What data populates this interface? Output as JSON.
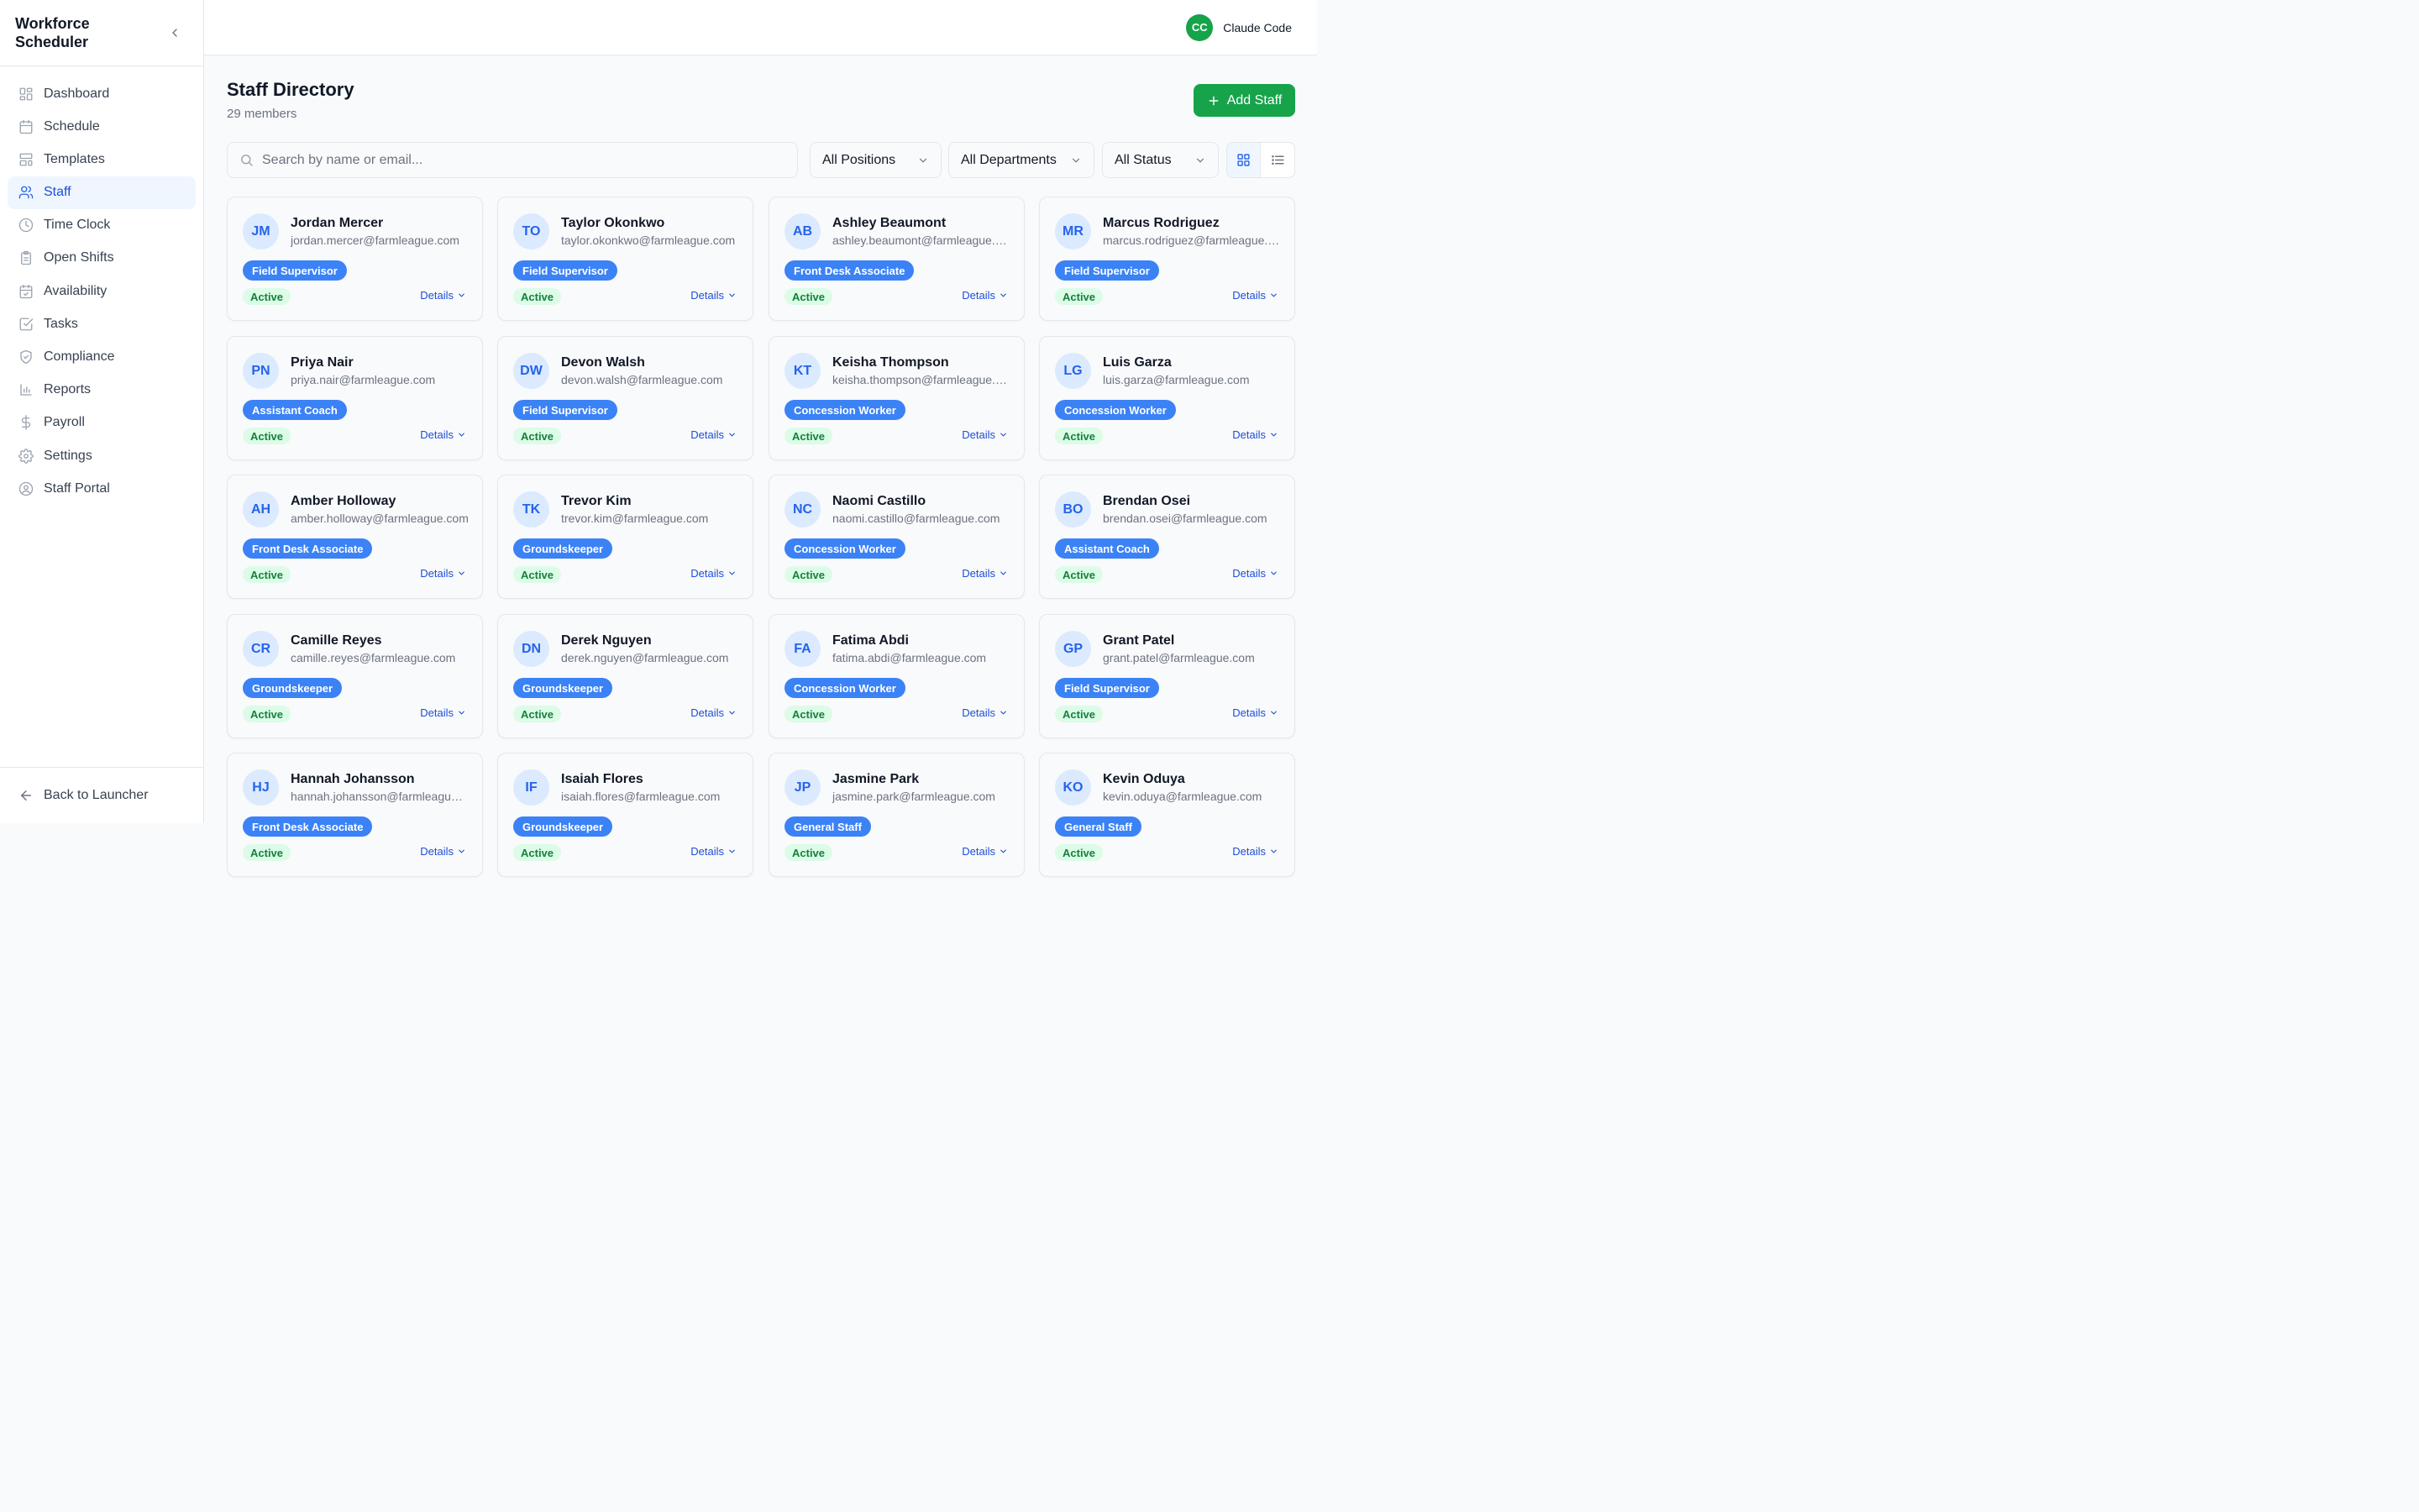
{
  "app": {
    "title": "Workforce Scheduler"
  },
  "sidebar": {
    "items": [
      {
        "label": "Dashboard",
        "icon": "dashboard-icon",
        "active": false
      },
      {
        "label": "Schedule",
        "icon": "calendar-icon",
        "active": false
      },
      {
        "label": "Templates",
        "icon": "template-icon",
        "active": false
      },
      {
        "label": "Staff",
        "icon": "users-icon",
        "active": true
      },
      {
        "label": "Time Clock",
        "icon": "clock-icon",
        "active": false
      },
      {
        "label": "Open Shifts",
        "icon": "clipboard-icon",
        "active": false
      },
      {
        "label": "Availability",
        "icon": "calendar-check-icon",
        "active": false
      },
      {
        "label": "Tasks",
        "icon": "checkbox-icon",
        "active": false
      },
      {
        "label": "Compliance",
        "icon": "shield-icon",
        "active": false
      },
      {
        "label": "Reports",
        "icon": "bar-chart-icon",
        "active": false
      },
      {
        "label": "Payroll",
        "icon": "dollar-icon",
        "active": false
      },
      {
        "label": "Settings",
        "icon": "gear-icon",
        "active": false
      },
      {
        "label": "Staff Portal",
        "icon": "user-circle-icon",
        "active": false
      }
    ],
    "footer": {
      "label": "Back to Launcher"
    }
  },
  "user": {
    "initials": "CC",
    "name": "Claude Code"
  },
  "page": {
    "title": "Staff Directory",
    "subtitle": "29 members",
    "add_button": "Add Staff"
  },
  "filters": {
    "search_placeholder": "Search by name or email...",
    "positions": "All Positions",
    "departments": "All Departments",
    "status": "All Status",
    "view": "grid"
  },
  "details_label": "Details",
  "staff": [
    {
      "initials": "JM",
      "name": "Jordan Mercer",
      "email": "jordan.mercer@farmleague.com",
      "role": "Field Supervisor",
      "status": "Active"
    },
    {
      "initials": "TO",
      "name": "Taylor Okonkwo",
      "email": "taylor.okonkwo@farmleague.com",
      "role": "Field Supervisor",
      "status": "Active"
    },
    {
      "initials": "AB",
      "name": "Ashley Beaumont",
      "email": "ashley.beaumont@farmleague.com",
      "role": "Front Desk Associate",
      "status": "Active"
    },
    {
      "initials": "MR",
      "name": "Marcus Rodriguez",
      "email": "marcus.rodriguez@farmleague.com",
      "role": "Field Supervisor",
      "status": "Active"
    },
    {
      "initials": "PN",
      "name": "Priya Nair",
      "email": "priya.nair@farmleague.com",
      "role": "Assistant Coach",
      "status": "Active"
    },
    {
      "initials": "DW",
      "name": "Devon Walsh",
      "email": "devon.walsh@farmleague.com",
      "role": "Field Supervisor",
      "status": "Active"
    },
    {
      "initials": "KT",
      "name": "Keisha Thompson",
      "email": "keisha.thompson@farmleague.com",
      "role": "Concession Worker",
      "status": "Active"
    },
    {
      "initials": "LG",
      "name": "Luis Garza",
      "email": "luis.garza@farmleague.com",
      "role": "Concession Worker",
      "status": "Active"
    },
    {
      "initials": "AH",
      "name": "Amber Holloway",
      "email": "amber.holloway@farmleague.com",
      "role": "Front Desk Associate",
      "status": "Active"
    },
    {
      "initials": "TK",
      "name": "Trevor Kim",
      "email": "trevor.kim@farmleague.com",
      "role": "Groundskeeper",
      "status": "Active"
    },
    {
      "initials": "NC",
      "name": "Naomi Castillo",
      "email": "naomi.castillo@farmleague.com",
      "role": "Concession Worker",
      "status": "Active"
    },
    {
      "initials": "BO",
      "name": "Brendan Osei",
      "email": "brendan.osei@farmleague.com",
      "role": "Assistant Coach",
      "status": "Active"
    },
    {
      "initials": "CR",
      "name": "Camille Reyes",
      "email": "camille.reyes@farmleague.com",
      "role": "Groundskeeper",
      "status": "Active"
    },
    {
      "initials": "DN",
      "name": "Derek Nguyen",
      "email": "derek.nguyen@farmleague.com",
      "role": "Groundskeeper",
      "status": "Active"
    },
    {
      "initials": "FA",
      "name": "Fatima Abdi",
      "email": "fatima.abdi@farmleague.com",
      "role": "Concession Worker",
      "status": "Active"
    },
    {
      "initials": "GP",
      "name": "Grant Patel",
      "email": "grant.patel@farmleague.com",
      "role": "Field Supervisor",
      "status": "Active"
    },
    {
      "initials": "HJ",
      "name": "Hannah Johansson",
      "email": "hannah.johansson@farmleague.com",
      "role": "Front Desk Associate",
      "status": "Active"
    },
    {
      "initials": "IF",
      "name": "Isaiah Flores",
      "email": "isaiah.flores@farmleague.com",
      "role": "Groundskeeper",
      "status": "Active"
    },
    {
      "initials": "JP",
      "name": "Jasmine Park",
      "email": "jasmine.park@farmleague.com",
      "role": "General Staff",
      "status": "Active"
    },
    {
      "initials": "KO",
      "name": "Kevin Oduya",
      "email": "kevin.oduya@farmleague.com",
      "role": "General Staff",
      "status": "Active"
    }
  ]
}
